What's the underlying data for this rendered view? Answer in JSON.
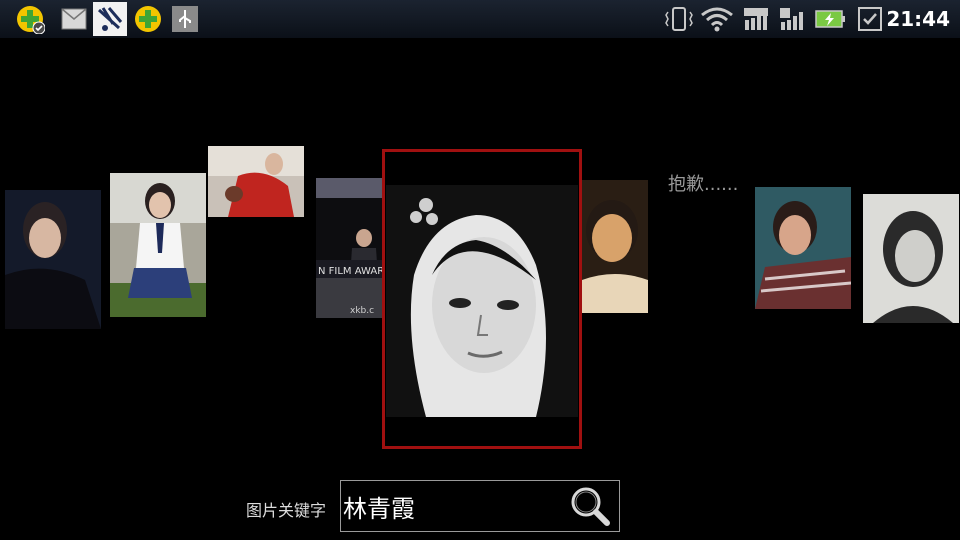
{
  "status_bar": {
    "time": "21:44",
    "notification_icons": [
      "360-security-icon",
      "sms-icon",
      "app-icon",
      "360-add-icon",
      "usb-icon"
    ],
    "system_icons": [
      "vibrate-icon",
      "wifi-icon",
      "signal-3g-icon",
      "signal-g-icon",
      "battery-charging-icon",
      "checkbox-icon"
    ]
  },
  "gallery": {
    "message": "抱歉......",
    "selected_index": 4
  },
  "search": {
    "label": "图片关键字",
    "value": "林青霞"
  },
  "colors": {
    "background": "#000000",
    "selected_border": "#a01010",
    "statusbar_bg": "#121923"
  }
}
